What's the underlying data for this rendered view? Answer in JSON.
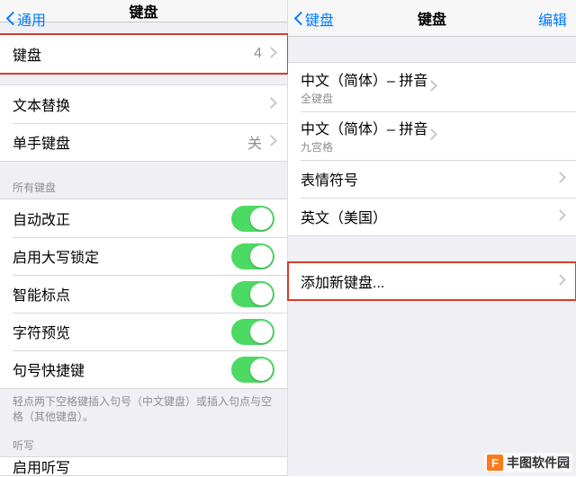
{
  "left": {
    "nav": {
      "back": "通用",
      "title": "键盘"
    },
    "keyboards_row": {
      "label": "键盘",
      "count": "4"
    },
    "rows2": [
      {
        "label": "文本替换"
      },
      {
        "label": "单手键盘",
        "value": "关"
      }
    ],
    "section_all": "所有键盘",
    "toggles": [
      {
        "label": "自动改正",
        "on": true
      },
      {
        "label": "启用大写锁定",
        "on": true
      },
      {
        "label": "智能标点",
        "on": true
      },
      {
        "label": "字符预览",
        "on": true
      },
      {
        "label": "句号快捷键",
        "on": true
      }
    ],
    "footer": "轻点两下空格键插入句号（中文键盘）或插入句点与空格（其他键盘）。",
    "section_dictation": "听写",
    "dictation_row": "启用听写"
  },
  "right": {
    "nav": {
      "back": "键盘",
      "title": "键盘",
      "edit": "编辑"
    },
    "keyboards": [
      {
        "title": "中文（简体）– 拼音",
        "sub": "全键盘"
      },
      {
        "title": "中文（简体）– 拼音",
        "sub": "九宫格"
      },
      {
        "title": "表情符号"
      },
      {
        "title": "英文（美国）"
      }
    ],
    "add": "添加新键盘..."
  },
  "watermark": {
    "badge": "F",
    "text": "丰图软件园"
  }
}
